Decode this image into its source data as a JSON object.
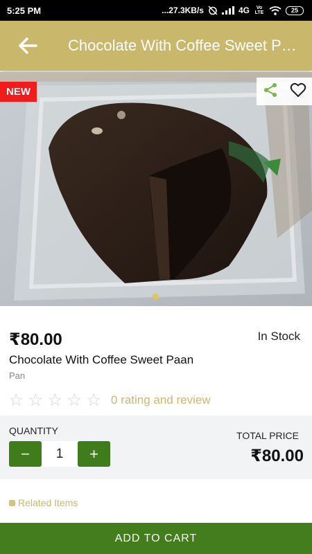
{
  "status_bar": {
    "time": "5:25 PM",
    "network_speed": "...27.3KB/s",
    "network_type": "4G",
    "volte": "Vo LTE",
    "battery": "25",
    "icons": [
      "alarm-off-icon",
      "signal-icon",
      "wifi-icon",
      "battery-icon"
    ]
  },
  "app_bar": {
    "title": "Chocolate With Coffee Sweet Paan",
    "back_icon": "arrow-left-icon",
    "color": "#c9b86c"
  },
  "hero": {
    "badge": "NEW",
    "badge_color": "#f21c1c",
    "share_icon": "share-icon",
    "favorite_icon": "heart-outline-icon",
    "carousel_pages": 1,
    "carousel_active": 1
  },
  "product": {
    "price": "₹80.00",
    "stock": "In Stock",
    "name": "Chocolate With Coffee Sweet Paan",
    "category": "Pan",
    "rating_stars": 0,
    "rating_max": 5,
    "rating_text": "0 rating and review"
  },
  "quantity": {
    "label": "QUANTITY",
    "value": "1",
    "minus": "−",
    "plus": "+",
    "total_label": "TOTAL PRICE",
    "total_value": "₹80.00"
  },
  "related": {
    "label": "Related Items"
  },
  "cart": {
    "label": "ADD TO CART",
    "color": "#437d1e"
  }
}
